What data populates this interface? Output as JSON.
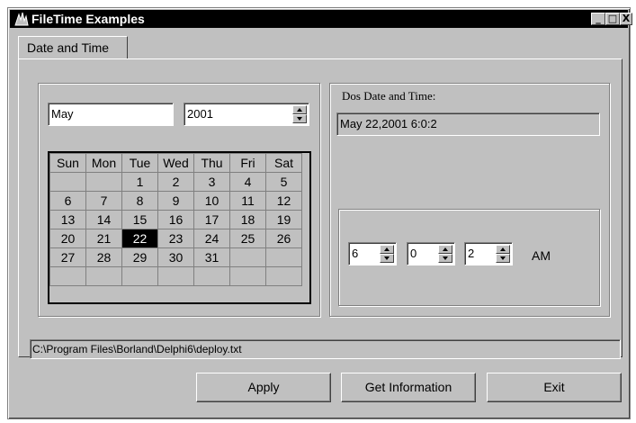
{
  "window": {
    "title": "FileTime Examples",
    "min_label": "_",
    "max_label": "□",
    "close_label": "X"
  },
  "tab": {
    "label": "Date and Time"
  },
  "calendar": {
    "month": "May",
    "year": "2001",
    "day_names": [
      "Sun",
      "Mon",
      "Tue",
      "Wed",
      "Thu",
      "Fri",
      "Sat"
    ],
    "weeks": [
      [
        "",
        "",
        "1",
        "2",
        "3",
        "4",
        "5"
      ],
      [
        "6",
        "7",
        "8",
        "9",
        "10",
        "11",
        "12"
      ],
      [
        "13",
        "14",
        "15",
        "16",
        "17",
        "18",
        "19"
      ],
      [
        "20",
        "21",
        "22",
        "23",
        "24",
        "25",
        "26"
      ],
      [
        "27",
        "28",
        "29",
        "30",
        "31",
        "",
        ""
      ],
      [
        "",
        "",
        "",
        "",
        "",
        "",
        ""
      ]
    ],
    "selected_day": "22"
  },
  "dos": {
    "label": "Dos Date and  Time:",
    "value": "May 22,2001  6:0:2",
    "hour": "6",
    "minute": "0",
    "second": "2",
    "ampm": "AM"
  },
  "status": {
    "path": "C:\\Program Files\\Borland\\Delphi6\\deploy.txt"
  },
  "buttons": {
    "apply": "Apply",
    "get_info": "Get Information",
    "exit": "Exit"
  }
}
